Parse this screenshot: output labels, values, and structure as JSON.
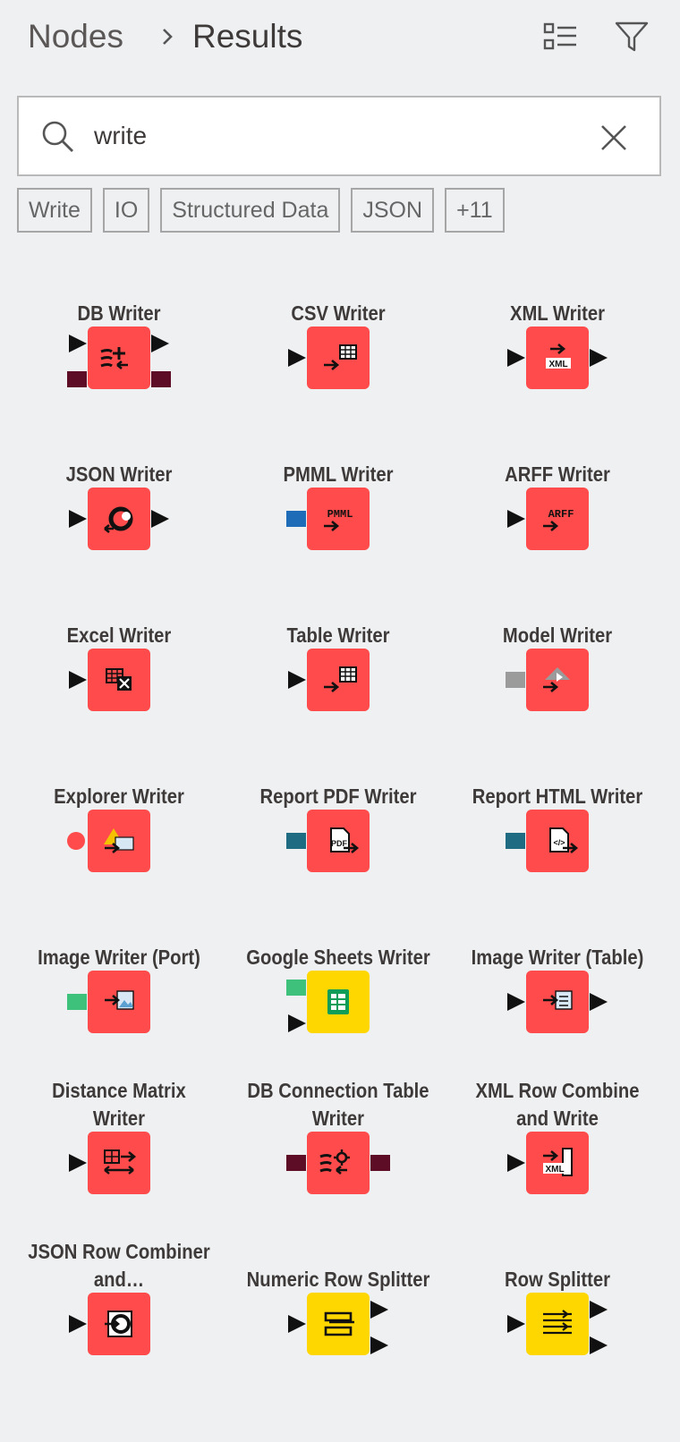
{
  "breadcrumb": {
    "root": "Nodes",
    "current": "Results"
  },
  "search": {
    "value": "write",
    "placeholder": ""
  },
  "tags": [
    "Write",
    "IO",
    "Structured Data",
    "JSON",
    "+11"
  ],
  "colors": {
    "background": "#eef0f2",
    "sink_node": "#ff4b4b",
    "manipulator_node": "#ffd700",
    "db_port": "#5d0d26",
    "pmml_port": "#1e6bb8",
    "image_port": "#3ec17b",
    "report_port": "#1e6b82",
    "model_port": "#9b9b9b"
  },
  "nodes": [
    {
      "name": "DB Writer",
      "icon": "db-writer-icon"
    },
    {
      "name": "CSV Writer",
      "icon": "csv-writer-icon"
    },
    {
      "name": "XML Writer",
      "icon": "xml-writer-icon"
    },
    {
      "name": "JSON Writer",
      "icon": "json-writer-icon"
    },
    {
      "name": "PMML Writer",
      "icon": "pmml-writer-icon"
    },
    {
      "name": "ARFF Writer",
      "icon": "arff-writer-icon"
    },
    {
      "name": "Excel Writer",
      "icon": "excel-writer-icon"
    },
    {
      "name": "Table Writer",
      "icon": "table-writer-icon"
    },
    {
      "name": "Model Writer",
      "icon": "model-writer-icon"
    },
    {
      "name": "Explorer Writer",
      "icon": "explorer-writer-icon"
    },
    {
      "name": "Report PDF Writer",
      "icon": "report-pdf-writer-icon"
    },
    {
      "name": "Report HTML Writer",
      "icon": "report-html-writer-icon"
    },
    {
      "name": "Image Writer (Port)",
      "icon": "image-writer-port-icon"
    },
    {
      "name": "Google Sheets Writer",
      "icon": "google-sheets-writer-icon"
    },
    {
      "name": "Image Writer (Table)",
      "icon": "image-writer-table-icon"
    },
    {
      "name": "Distance Matrix Writer",
      "icon": "distance-matrix-writer-icon"
    },
    {
      "name": "DB Connection Table Writer",
      "icon": "db-connection-table-writer-icon"
    },
    {
      "name": "XML Row Combine and Write",
      "icon": "xml-row-combine-write-icon"
    },
    {
      "name": "JSON Row Combiner and…",
      "icon": "json-row-combiner-icon"
    },
    {
      "name": "Numeric Row Splitter",
      "icon": "numeric-row-splitter-icon"
    },
    {
      "name": "Row Splitter",
      "icon": "row-splitter-icon"
    }
  ]
}
